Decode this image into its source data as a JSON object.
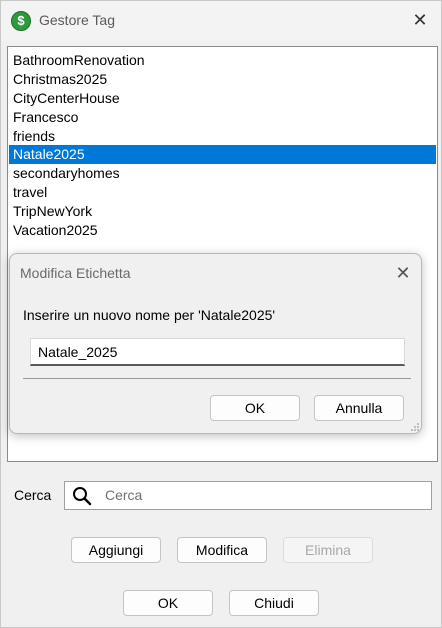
{
  "window": {
    "title": "Gestore Tag",
    "close_glyph": "✕",
    "app_icon_glyph": "$"
  },
  "tags": {
    "items": [
      "BathroomRenovation",
      "Christmas2025",
      "CityCenterHouse",
      "Francesco",
      "friends",
      "Natale2025",
      "secondaryhomes",
      "travel",
      "TripNewYork",
      "Vacation2025"
    ],
    "selected_index": 5
  },
  "rename_dialog": {
    "title": "Modifica Etichetta",
    "close_glyph": "✕",
    "prompt": "Inserire un nuovo nome per 'Natale2025'",
    "value": "Natale_2025",
    "ok_label": "OK",
    "cancel_label": "Annulla"
  },
  "search": {
    "label": "Cerca",
    "placeholder": "Cerca"
  },
  "actions": {
    "add_label": "Aggiungi",
    "edit_label": "Modifica",
    "delete_label": "Elimina"
  },
  "footer": {
    "ok_label": "OK",
    "close_label": "Chiudi"
  },
  "colors": {
    "selection": "#0078d7",
    "app_icon": "#2e9a3a"
  }
}
